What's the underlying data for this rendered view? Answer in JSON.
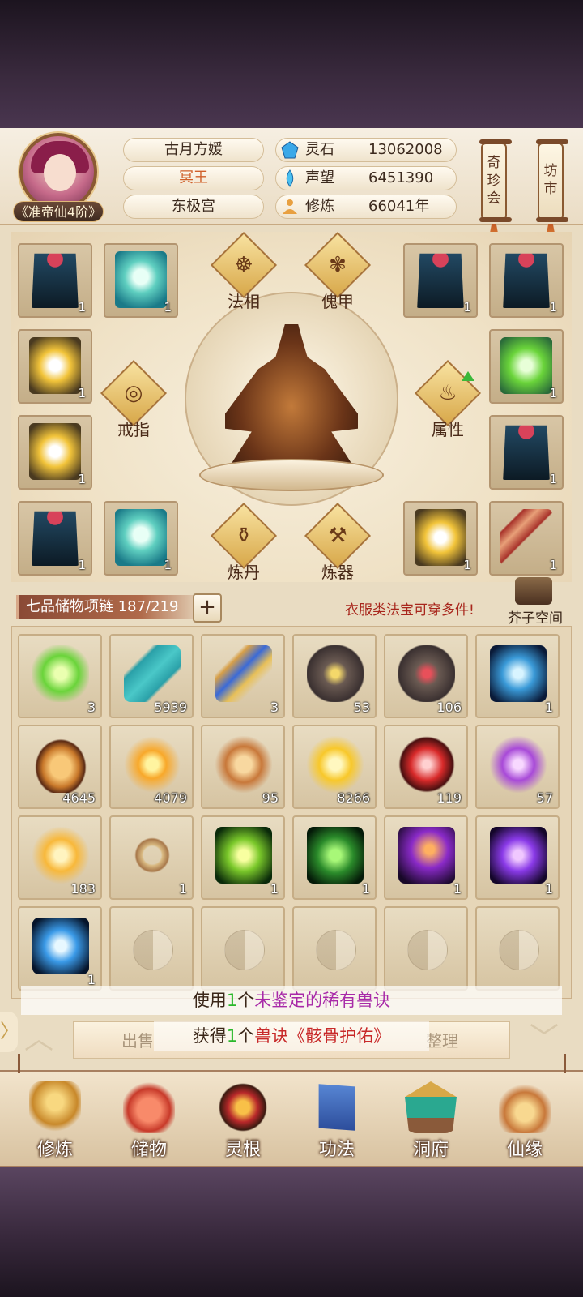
{
  "player": {
    "name": "古月方媛",
    "title": "冥王",
    "sect": "东极宫",
    "rank": "《准帝仙4阶》"
  },
  "stats": [
    {
      "icon": "spirit-stone-icon",
      "label": "灵石",
      "value": "13062008"
    },
    {
      "icon": "reputation-icon",
      "label": "声望",
      "value": "6451390"
    },
    {
      "icon": "cultivation-icon",
      "label": "修炼",
      "value": "66041年"
    }
  ],
  "scrolls": {
    "treasure": "奇珍会",
    "market": "坊市"
  },
  "equipment": {
    "labels": {
      "faxiang": "法相",
      "kuijia": "傀甲",
      "ring": "戒指",
      "attribute": "属性",
      "alchemy": "炼丹",
      "forge": "炼器"
    },
    "slots": [
      {
        "kind": "robe",
        "qty": "1"
      },
      {
        "kind": "armor-teal",
        "qty": "1"
      },
      {
        "kind": "robe",
        "qty": "1"
      },
      {
        "kind": "robe",
        "qty": "1"
      },
      {
        "kind": "armor-gold",
        "qty": "1"
      },
      {
        "kind": "armor-green",
        "qty": "1"
      },
      {
        "kind": "armor-gold",
        "qty": "1"
      },
      {
        "kind": "robe",
        "qty": "1"
      },
      {
        "kind": "robe",
        "qty": "1"
      },
      {
        "kind": "armor-teal",
        "qty": "1"
      },
      {
        "kind": "armor-gold",
        "qty": "1"
      },
      {
        "kind": "bow",
        "qty": "1"
      }
    ]
  },
  "storage": {
    "label": "七品储物项链 187/219",
    "note": "衣服类法宝可穿多件!",
    "mustard_space": "芥子空间"
  },
  "bag": [
    {
      "art": "green",
      "qty": "3"
    },
    {
      "art": "scroll-teal",
      "qty": "5939"
    },
    {
      "art": "scroll-blue",
      "qty": "3"
    },
    {
      "art": "rock",
      "qty": "53"
    },
    {
      "art": "rock-red",
      "qty": "106"
    },
    {
      "art": "orb-blue",
      "qty": "1"
    },
    {
      "art": "sand",
      "qty": "4645"
    },
    {
      "art": "drop",
      "qty": "4079"
    },
    {
      "art": "dragon",
      "qty": "95"
    },
    {
      "art": "gold",
      "qty": "8266"
    },
    {
      "art": "red",
      "qty": "119"
    },
    {
      "art": "purple",
      "qty": "57"
    },
    {
      "art": "nuggets",
      "qty": "183"
    },
    {
      "art": "beads",
      "qty": "1"
    },
    {
      "art": "green-drop",
      "qty": "1"
    },
    {
      "art": "green-vortex",
      "qty": "1"
    },
    {
      "art": "purple-hand",
      "qty": "1"
    },
    {
      "art": "purple-flame",
      "qty": "1"
    },
    {
      "art": "skull",
      "qty": "1"
    },
    {
      "art": "",
      "qty": ""
    },
    {
      "art": "",
      "qty": ""
    },
    {
      "art": "",
      "qty": ""
    },
    {
      "art": "",
      "qty": ""
    },
    {
      "art": "",
      "qty": ""
    }
  ],
  "toasts": {
    "first": {
      "a": "使用",
      "b": "1",
      "c": "个",
      "d": "未鉴定的稀有兽诀"
    },
    "second": {
      "a": "获得",
      "b": "1",
      "c": "个",
      "d": "兽诀《骸骨护佑》"
    }
  },
  "actions": {
    "sell": "出售",
    "sort": "整理"
  },
  "nav": [
    {
      "icon": "cultivate-icon",
      "label": "修炼"
    },
    {
      "icon": "storage-bag-icon",
      "label": "储物"
    },
    {
      "icon": "spirit-root-icon",
      "label": "灵根"
    },
    {
      "icon": "skill-book-icon",
      "label": "功法"
    },
    {
      "icon": "cave-house-icon",
      "label": "洞府"
    },
    {
      "icon": "fate-gourd-icon",
      "label": "仙缘"
    }
  ]
}
